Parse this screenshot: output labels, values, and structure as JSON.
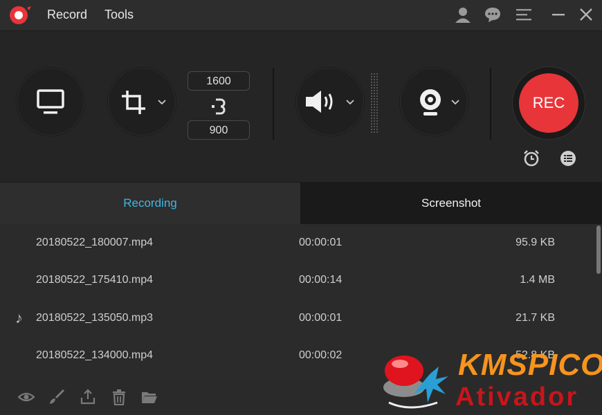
{
  "app": {
    "menu": [
      "Record",
      "Tools"
    ],
    "accent": "#3fb8e3",
    "rec_color": "#e8353a"
  },
  "titlebar_icons": [
    "user-icon",
    "chat-icon",
    "menu-icon",
    "minimize-icon",
    "close-icon"
  ],
  "toolbar": {
    "width": "1600",
    "height": "900",
    "rec_label": "REC"
  },
  "tabs": {
    "recording": "Recording",
    "screenshot": "Screenshot"
  },
  "files": [
    {
      "name": "20180522_180007.mp4",
      "duration": "00:00:01",
      "size": "95.9 KB",
      "audio": false
    },
    {
      "name": "20180522_175410.mp4",
      "duration": "00:00:14",
      "size": "1.4 MB",
      "audio": false
    },
    {
      "name": "20180522_135050.mp3",
      "duration": "00:00:01",
      "size": "21.7 KB",
      "audio": true
    },
    {
      "name": "20180522_134000.mp4",
      "duration": "00:00:02",
      "size": "52.8 KB",
      "audio": false
    }
  ],
  "bottom_icons": [
    "eye-icon",
    "brush-icon",
    "share-icon",
    "trash-icon",
    "folder-icon"
  ],
  "watermark": {
    "line1": "KMSPICO",
    "line2": "Ativador"
  }
}
